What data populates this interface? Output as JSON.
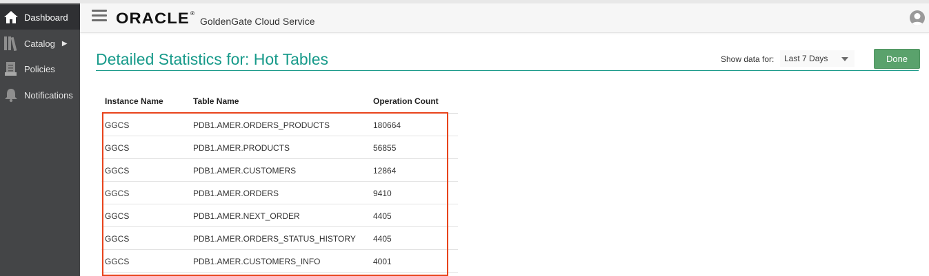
{
  "sidebar": {
    "items": [
      {
        "label": "Dashboard",
        "icon": "home-icon",
        "active": true
      },
      {
        "label": "Catalog",
        "icon": "catalog-icon",
        "active": false,
        "has_submenu": true
      },
      {
        "label": "Policies",
        "icon": "policies-icon",
        "active": false
      },
      {
        "label": "Notifications",
        "icon": "bell-icon",
        "active": false
      }
    ]
  },
  "header": {
    "brand": "ORACLE",
    "brand_reg": "®",
    "service": "GoldenGate Cloud Service"
  },
  "main": {
    "title": "Detailed Statistics for: Hot Tables",
    "show_data_label": "Show data for:",
    "range_selected": "Last 7 Days",
    "done_label": "Done"
  },
  "table": {
    "columns": [
      "Instance Name",
      "Table Name",
      "Operation Count"
    ],
    "rows": [
      [
        "GGCS",
        "PDB1.AMER.ORDERS_PRODUCTS",
        "180664"
      ],
      [
        "GGCS",
        "PDB1.AMER.PRODUCTS",
        "56855"
      ],
      [
        "GGCS",
        "PDB1.AMER.CUSTOMERS",
        "12864"
      ],
      [
        "GGCS",
        "PDB1.AMER.ORDERS",
        "9410"
      ],
      [
        "GGCS",
        "PDB1.AMER.NEXT_ORDER",
        "4405"
      ],
      [
        "GGCS",
        "PDB1.AMER.ORDERS_STATUS_HISTORY",
        "4405"
      ],
      [
        "GGCS",
        "PDB1.AMER.CUSTOMERS_INFO",
        "4001"
      ]
    ]
  },
  "colors": {
    "accent": "#179a8a",
    "done_button": "#5aa26c",
    "highlight": "#e8431b",
    "sidebar_bg": "#444547"
  }
}
